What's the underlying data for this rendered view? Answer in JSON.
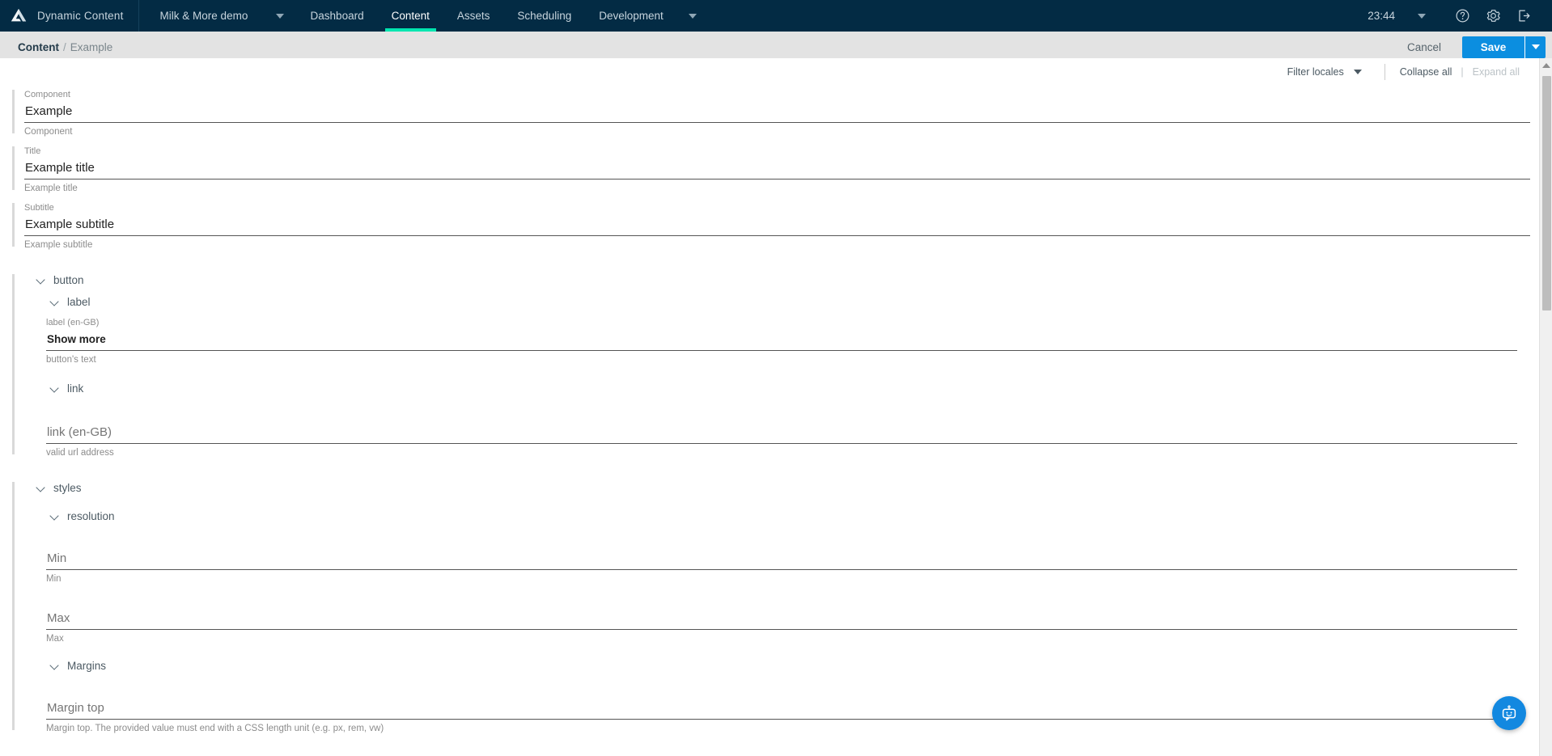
{
  "topnav": {
    "logo_icon": "amplience-logo-icon",
    "brand": "Dynamic Content",
    "hub": "Milk & More demo",
    "hub_caret_icon": "chevron-down-icon",
    "tabs": [
      {
        "label": "Dashboard",
        "active": false
      },
      {
        "label": "Content",
        "active": true
      },
      {
        "label": "Assets",
        "active": false
      },
      {
        "label": "Scheduling",
        "active": false
      },
      {
        "label": "Development",
        "active": false
      }
    ],
    "tabs_overflow_icon": "chevron-down-icon",
    "time": "23:44",
    "time_caret_icon": "chevron-down-icon",
    "help_icon": "help-circle-icon",
    "settings_icon": "gear-icon",
    "logout_icon": "logout-icon",
    "active_accent_color": "#00e6b0",
    "background_color": "#032b44"
  },
  "breadcrumb": {
    "root": "Content",
    "separator": "/",
    "leaf": "Example"
  },
  "actions": {
    "cancel_label": "Cancel",
    "save_label": "Save",
    "save_caret_icon": "chevron-down-icon",
    "save_color": "#0b8ee0"
  },
  "form_toolbar": {
    "filter_locales_label": "Filter locales",
    "filter_locales_caret_icon": "chevron-down-icon",
    "collapse_all_label": "Collapse all",
    "pipe": "|",
    "expand_all_label": "Expand all",
    "expand_all_disabled": true
  },
  "fields": {
    "component": {
      "label": "Component",
      "value": "Example",
      "help": "Component"
    },
    "title": {
      "label": "Title",
      "value": "Example title",
      "help": "Example title"
    },
    "subtitle": {
      "label": "Subtitle",
      "value": "Example subtitle",
      "help": "Example subtitle"
    }
  },
  "groups": {
    "button": {
      "title": "button",
      "caret_icon": "chevron-down-icon",
      "label_group": {
        "title": "label",
        "caret_icon": "chevron-down-icon",
        "field": {
          "label": "label (en-GB)",
          "value": "Show more",
          "help": "button's text"
        }
      },
      "link_group": {
        "title": "link",
        "caret_icon": "chevron-down-icon",
        "field": {
          "placeholder": "link (en-GB)",
          "value": "",
          "help": "valid url address"
        }
      }
    },
    "styles": {
      "title": "styles",
      "caret_icon": "chevron-down-icon",
      "resolution_group": {
        "title": "resolution",
        "caret_icon": "chevron-down-icon",
        "min": {
          "placeholder": "Min",
          "value": "",
          "help": "Min"
        },
        "max": {
          "placeholder": "Max",
          "value": "",
          "help": "Max"
        }
      },
      "margins_group": {
        "title": "Margins",
        "caret_icon": "chevron-down-icon",
        "margin_top": {
          "placeholder": "Margin top",
          "value": "",
          "help": "Margin top. The provided value must end with a CSS length unit (e.g. px, rem, vw)"
        }
      }
    }
  },
  "scrollbar": {
    "up_arrow_icon": "chevron-up-icon"
  },
  "chat": {
    "icon": "chatbot-icon",
    "color": "#1288e0"
  }
}
